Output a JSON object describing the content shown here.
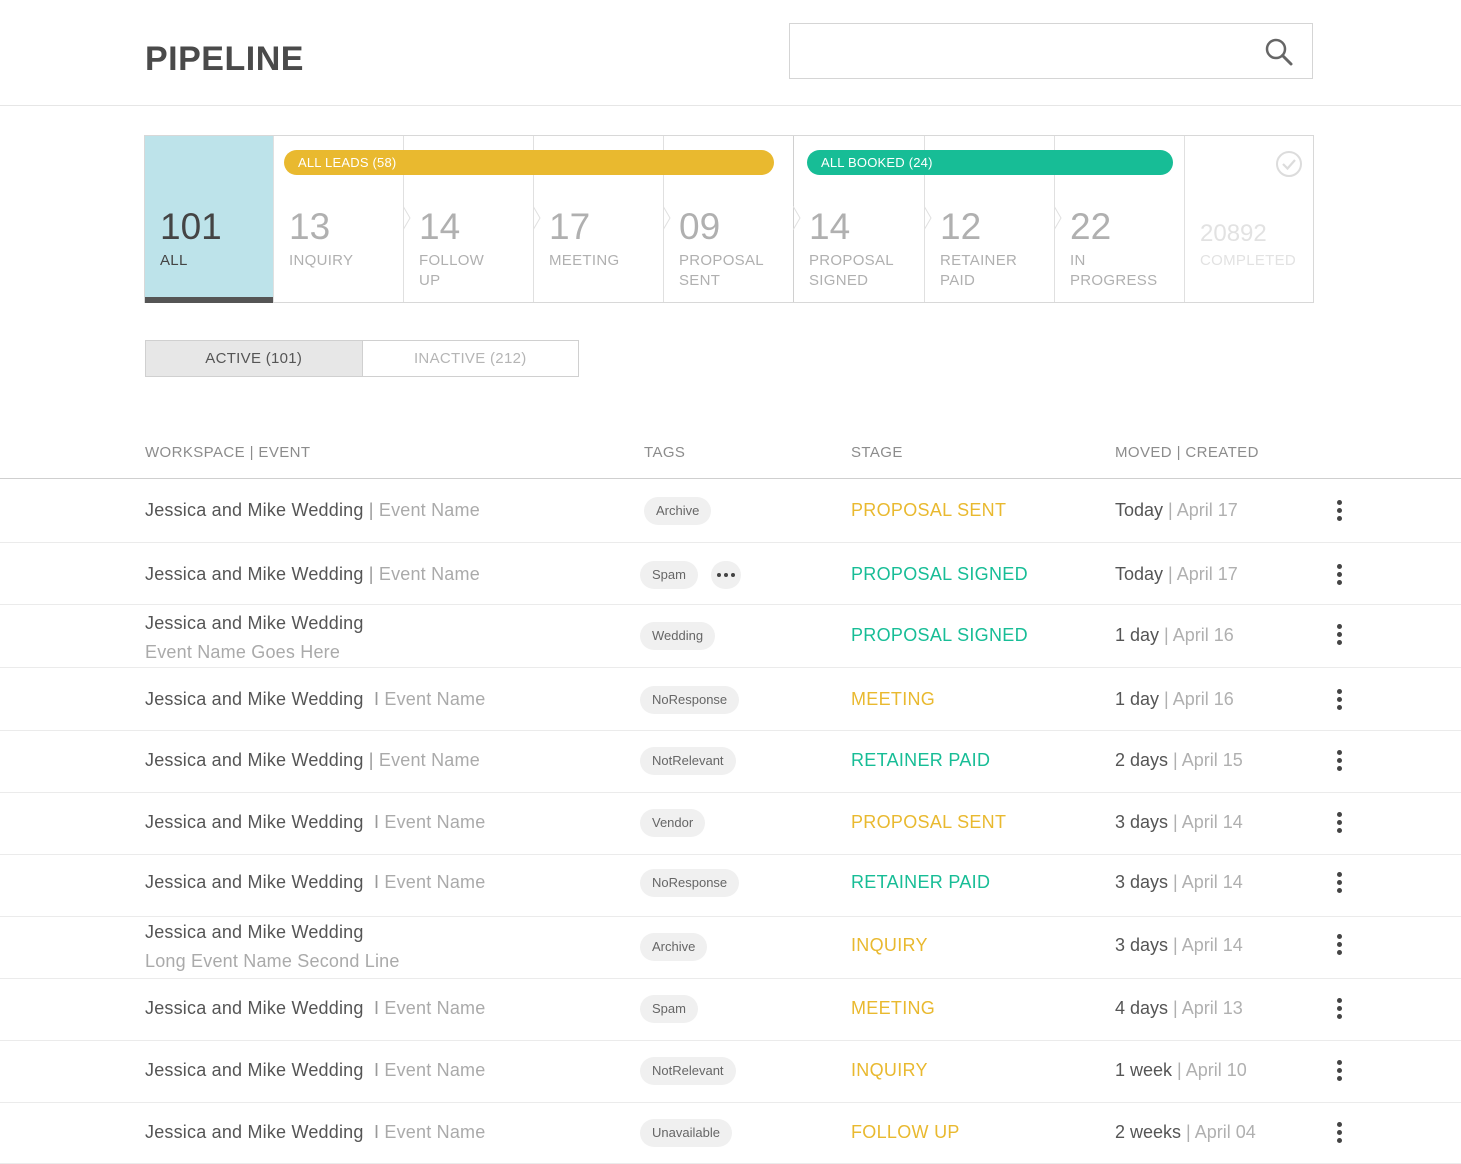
{
  "header": {
    "title": "PIPELINE",
    "search_placeholder": "",
    "search_icon": "search-icon"
  },
  "pills": {
    "leads": "ALL LEADS (58)",
    "booked": "ALL BOOKED (24)"
  },
  "stages": [
    {
      "count": "101",
      "label": "ALL"
    },
    {
      "count": "13",
      "label": "INQUIRY"
    },
    {
      "count": "14",
      "label": "FOLLOW UP"
    },
    {
      "count": "17",
      "label": "MEETING"
    },
    {
      "count": "09",
      "label": "PROPOSAL SENT"
    },
    {
      "count": "14",
      "label": "PROPOSAL SIGNED"
    },
    {
      "count": "12",
      "label": "RETAINER PAID"
    },
    {
      "count": "22",
      "label": "IN PROGRESS"
    },
    {
      "count": "20892",
      "label": "COMPLETED"
    }
  ],
  "toggle": {
    "active": "ACTIVE (101)",
    "inactive": "INACTIVE (212)"
  },
  "table": {
    "headers": [
      "WORKSPACE | EVENT",
      "TAGS",
      "STAGE",
      "MOVED | CREATED"
    ],
    "rows": [
      {
        "workspace": "Jessica and Mike Wedding",
        "sep": " | ",
        "event": "Event Name",
        "tag": "Archive",
        "stage": "PROPOSAL SENT",
        "moved": "Today",
        "created": "April 17"
      },
      {
        "workspace": "Jessica and Mike Wedding",
        "sep": " | ",
        "event": "Event Name",
        "tag": "Spam",
        "stage": "PROPOSAL SIGNED",
        "moved": "Today",
        "created": "April 17"
      },
      {
        "workspace": "Jessica and Mike Wedding",
        "sep": "",
        "event": "Event Name Goes Here",
        "tag": "Wedding",
        "stage": "PROPOSAL SIGNED",
        "moved": "1 day",
        "created": "April 16"
      },
      {
        "workspace": "Jessica and Mike Wedding",
        "sep": "  I ",
        "event": "Event Name",
        "tag": "NoResponse",
        "stage": "MEETING",
        "moved": "1 day",
        "created": "April 16"
      },
      {
        "workspace": "Jessica and Mike Wedding",
        "sep": " | ",
        "event": "Event Name",
        "tag": "NotRelevant",
        "stage": "RETAINER PAID",
        "moved": "2 days",
        "created": "April 15"
      },
      {
        "workspace": "Jessica and Mike Wedding",
        "sep": "  I ",
        "event": "Event Name",
        "tag": "Vendor",
        "stage": "PROPOSAL SENT",
        "moved": "3 days",
        "created": "April 14"
      },
      {
        "workspace": "Jessica and Mike Wedding",
        "sep": "  I ",
        "event": "Event Name",
        "tag": "NoResponse",
        "stage": "RETAINER PAID",
        "moved": "3 days",
        "created": "April 14"
      },
      {
        "workspace": "Jessica and Mike Wedding",
        "sep": "",
        "event": "Long Event Name Second Line",
        "tag": "Archive",
        "stage": "INQUIRY",
        "moved": "3 days",
        "created": "April 14"
      },
      {
        "workspace": "Jessica and Mike Wedding",
        "sep": "  I ",
        "event": "Event Name",
        "tag": "Spam",
        "stage": "MEETING",
        "moved": "4 days",
        "created": "April 13"
      },
      {
        "workspace": "Jessica and Mike Wedding",
        "sep": "  I ",
        "event": "Event Name",
        "tag": "NotRelevant",
        "stage": "INQUIRY",
        "moved": "1 week",
        "created": "April 10"
      },
      {
        "workspace": "Jessica and Mike Wedding",
        "sep": "  I ",
        "event": "Event Name",
        "tag": "Unavailable",
        "stage": "FOLLOW UP",
        "moved": "2 weeks",
        "created": "April 04"
      }
    ]
  },
  "colors": {
    "accent_yellow": "#e9b92f",
    "accent_green": "#17bd96",
    "all_stage_bg": "#bde3ea"
  }
}
